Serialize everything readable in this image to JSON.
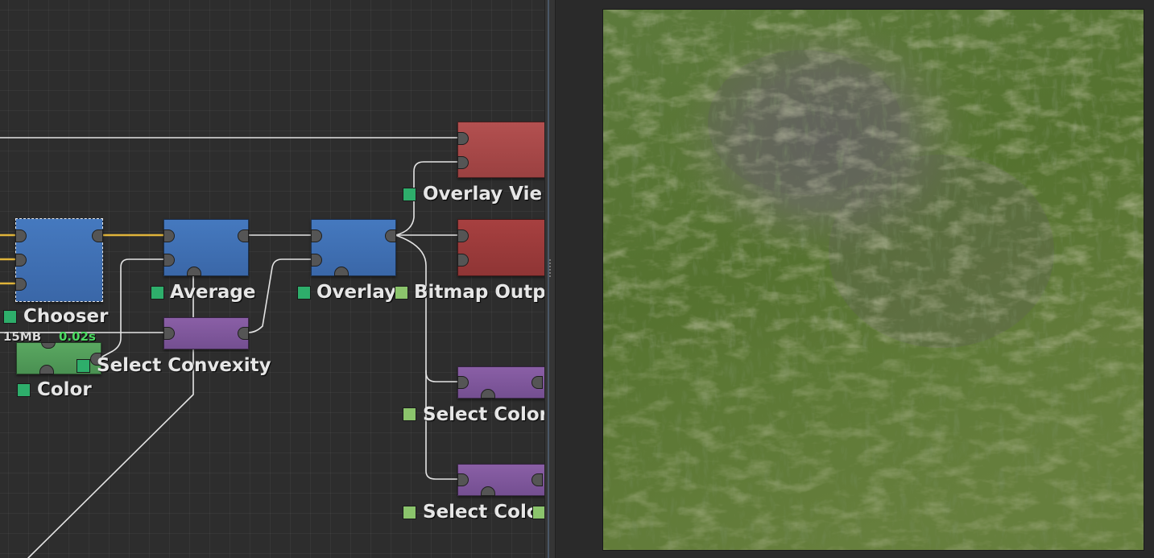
{
  "graph": {
    "nodes": {
      "chooser": {
        "label": "Chooser",
        "memory": "15MB",
        "time": "0.02s"
      },
      "color": {
        "label": "Color"
      },
      "average": {
        "label": "Average"
      },
      "select_convexity": {
        "label": "Select Convexity"
      },
      "overlay": {
        "label": "Overlay"
      },
      "overlay_view": {
        "label": "Overlay Vie"
      },
      "bitmap_output": {
        "label": "Bitmap Outp"
      },
      "select_color_1": {
        "label": "Select Color"
      },
      "select_color_2": {
        "label": "Select Colo"
      }
    },
    "colors": {
      "node_blue": "#4579bf",
      "node_red": "#a74040",
      "node_purple": "#8a5fa6",
      "node_green": "#5aa861",
      "wire_selected": "#e0b43a",
      "wire": "#e0e0e0",
      "status_green": "#2eae6b",
      "time_text": "#4cdb62"
    }
  },
  "preview": {
    "content": "terrain-texture",
    "colors": {
      "grass": "#5a7a38",
      "rock": "#6a6a62",
      "sediment": "#9a9a6a"
    }
  }
}
